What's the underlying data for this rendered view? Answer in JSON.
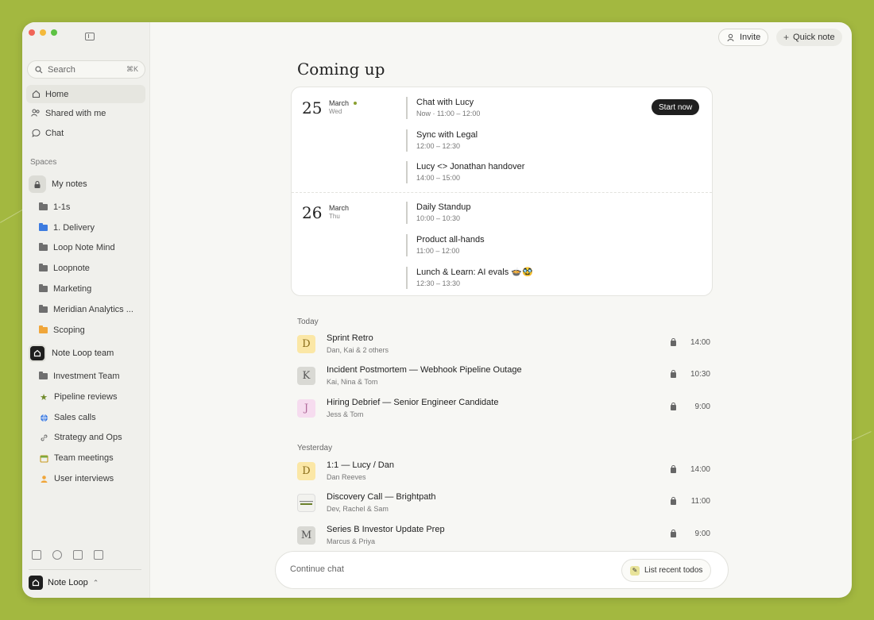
{
  "sidebar": {
    "search_placeholder": "Search",
    "search_shortcut": "⌘K",
    "nav": [
      {
        "label": "Home",
        "icon": "home-icon"
      },
      {
        "label": "Shared with me",
        "icon": "people-icon"
      },
      {
        "label": "Chat",
        "icon": "chat-icon"
      }
    ],
    "spaces_label": "Spaces",
    "my_notes": {
      "label": "My notes",
      "folders": [
        "1-1s",
        "1. Delivery",
        "Loop Note Mind",
        "Loopnote",
        "Marketing",
        "Meridian Analytics ...",
        "Scoping"
      ]
    },
    "team": {
      "label": "Note Loop team",
      "folders": [
        "Investment Team",
        "Pipeline reviews",
        "Sales calls",
        "Strategy and Ops",
        "Team meetings",
        "User interviews"
      ]
    },
    "workspace_name": "Note Loop",
    "workspace_chevron": "⌃"
  },
  "header": {
    "invite_label": "Invite",
    "quick_note_label": "Quick note"
  },
  "main": {
    "title": "Coming up",
    "days": [
      {
        "num": "25",
        "month": "March",
        "weekday": "Wed",
        "events": [
          {
            "title": "Chat with Lucy",
            "time": "Now · 11:00 – 12:00"
          },
          {
            "title": "Sync with Legal",
            "time": "12:00 – 12:30"
          },
          {
            "title": "Lucy <> Jonathan handover",
            "time": "14:00 – 15:00"
          }
        ]
      },
      {
        "num": "26",
        "month": "March",
        "weekday": "Thu",
        "events": [
          {
            "title": "Daily Standup",
            "time": "10:00 – 10:30"
          },
          {
            "title": "Product all-hands",
            "time": "11:00 – 12:00"
          },
          {
            "title": "Lunch & Learn: AI evals 🍲🥸",
            "time": "12:30 – 13:30"
          }
        ]
      }
    ],
    "start_now_label": "Start now",
    "today_label": "Today",
    "today": [
      {
        "avatar": "D",
        "title": "Sprint Retro",
        "people": "Dan, Kai & 2 others",
        "time": "14:00"
      },
      {
        "avatar": "K",
        "title": "Incident Postmortem — Webhook Pipeline Outage",
        "people": "Kai, Nina & Tom",
        "time": "10:30"
      },
      {
        "avatar": "J",
        "title": "Hiring Debrief — Senior Engineer Candidate",
        "people": "Jess & Tom",
        "time": "9:00"
      }
    ],
    "yesterday_label": "Yesterday",
    "yesterday": [
      {
        "avatar": "D",
        "title": "1:1 — Lucy / Dan",
        "people": "Dan Reeves",
        "time": "14:00"
      },
      {
        "avatar": "",
        "title": "Discovery Call — Brightpath",
        "people": "Dev, Rachel & Sam",
        "time": "11:00"
      },
      {
        "avatar": "M",
        "title": "Series B Investor Update Prep",
        "people": "Marcus & Priya",
        "time": "9:00"
      }
    ]
  },
  "chat": {
    "placeholder": "Continue chat",
    "suggestion": "List recent todos"
  },
  "colors": {
    "background": "#a3b840",
    "accent_dark": "#1f1f1f",
    "avatar_yellow": "#fbe7a6",
    "avatar_gray": "#d9d9d4",
    "avatar_pink": "#f6dcef"
  }
}
